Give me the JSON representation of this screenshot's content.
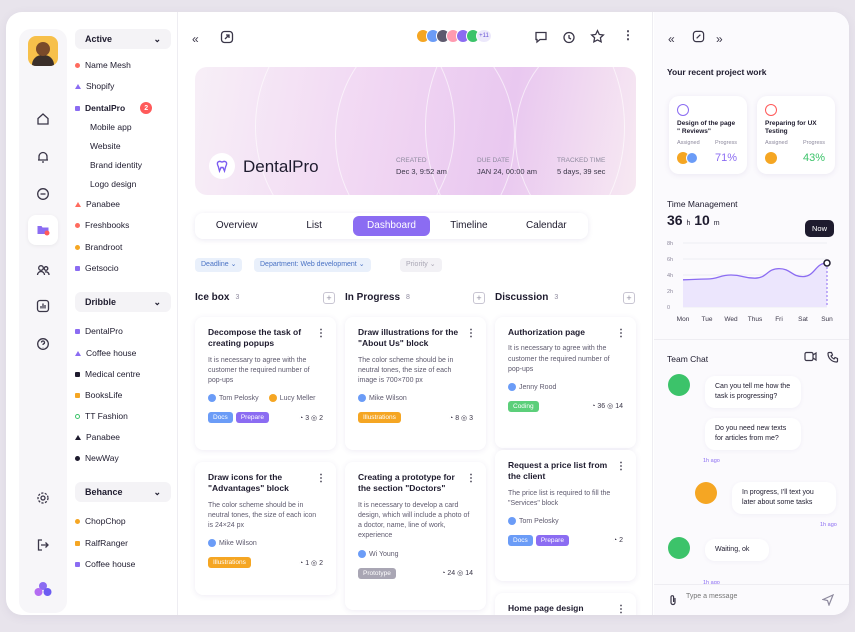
{
  "sidebar_workspaces": [
    {
      "select": "Active",
      "items": [
        {
          "label": "Name Mesh",
          "color": "#ff6b5e",
          "shape": "dot"
        },
        {
          "label": "Shopify",
          "color": "#8b6cf2",
          "shape": "tri"
        },
        {
          "label": "DentalPro",
          "color": "#8b6cf2",
          "shape": "sq",
          "badge": "2",
          "bold": true
        },
        {
          "label": "Mobile app",
          "sub": true
        },
        {
          "label": "Website",
          "sub": true
        },
        {
          "label": "Brand identity",
          "sub": true
        },
        {
          "label": "Logo design",
          "sub": true
        },
        {
          "label": "Panabee",
          "color": "#ff6b5e",
          "shape": "tri"
        },
        {
          "label": "Freshbooks",
          "color": "#ff6b5e",
          "shape": "dot"
        },
        {
          "label": "Brandroot",
          "color": "#f5a623",
          "shape": "dot"
        },
        {
          "label": "Getsocio",
          "color": "#8b6cf2",
          "shape": "sq"
        }
      ]
    },
    {
      "select": "Dribble",
      "items": [
        {
          "label": "DentalPro",
          "color": "#8b6cf2",
          "shape": "sq"
        },
        {
          "label": "Coffee house",
          "color": "#8b6cf2",
          "shape": "tri"
        },
        {
          "label": "Medical centre",
          "color": "#1e1b2e",
          "shape": "sq"
        },
        {
          "label": "BooksLife",
          "color": "#f5a623",
          "shape": "sq"
        },
        {
          "label": "TT Fashion",
          "color": "#3cc36a",
          "shape": "ring"
        },
        {
          "label": "Panabee",
          "color": "#1e1b2e",
          "shape": "tri"
        },
        {
          "label": "NewWay",
          "color": "#1e1b2e",
          "shape": "dot"
        }
      ]
    },
    {
      "select": "Behance",
      "items": [
        {
          "label": "ChopChop",
          "color": "#f5a623",
          "shape": "dot"
        },
        {
          "label": "RalfRanger",
          "color": "#f5a623",
          "shape": "sq"
        },
        {
          "label": "Coffee house",
          "color": "#8b6cf2",
          "shape": "sq"
        }
      ]
    }
  ],
  "header": {
    "people_more": "+11"
  },
  "project": {
    "name": "DentalPro",
    "created_label": "CREATED",
    "created": "Dec 3, 9:52 am",
    "due_label": "DUE DATE",
    "due": "JAN 24, 00:00 am",
    "tracked_label": "TRACKED TIME",
    "tracked": "5 days, 39 sec"
  },
  "tabs": [
    "Overview",
    "List",
    "Dashboard",
    "Timeline",
    "Calendar"
  ],
  "active_tab": "Dashboard",
  "filters": {
    "deadline": "Deadline",
    "department": "Department: Web development",
    "priority": "Priority"
  },
  "columns": [
    {
      "title": "Ice box",
      "count": "3",
      "cards": [
        {
          "title": "Decompose the task of creating popups",
          "desc": "It is necessary to agree with the customer the required number of pop-ups",
          "people": [
            "Tom Pelosky",
            "Lucy Meller"
          ],
          "tags": [
            {
              "t": "Docs",
              "c": "#6b9cf7"
            },
            {
              "t": "Prepare",
              "c": "#8b6cf2"
            }
          ],
          "comments": "3",
          "files": "2"
        },
        {
          "title": "Draw icons for the \"Advantages\" block",
          "desc": "The color scheme should be in neutral tones, the size of each icon is 24×24 px",
          "people": [
            "Mike Wilson"
          ],
          "tags": [
            {
              "t": "Illustrations",
              "c": "#f5a623"
            }
          ],
          "comments": "1",
          "files": "2"
        }
      ]
    },
    {
      "title": "In Progress",
      "count": "8",
      "cards": [
        {
          "title": "Draw illustrations for the \"About Us\" block",
          "desc": "The color scheme should be in neutral tones, the size of each image is 700×700 px",
          "people": [
            "Mike Wilson"
          ],
          "tags": [
            {
              "t": "Illustrations",
              "c": "#f5a623"
            }
          ],
          "comments": "8",
          "files": "3"
        },
        {
          "title": "Creating a prototype for the section \"Doctors\"",
          "desc": "It is necessary to develop a card design, which will include a photo of a doctor, name, line of work, experience",
          "people": [
            "Wi Young"
          ],
          "tags": [
            {
              "t": "Prototype",
              "c": "#a9a6b4"
            }
          ],
          "comments": "24",
          "files": "14"
        }
      ]
    },
    {
      "title": "Discussion",
      "count": "3",
      "cards": [
        {
          "title": "Authorization page",
          "desc": "It is necessary to agree with the customer the required number of pop-ups",
          "people": [
            "Jenny Rood"
          ],
          "tags": [
            {
              "t": "Coding",
              "c": "#5ccf7a"
            }
          ],
          "comments": "36",
          "files": "14"
        },
        {
          "title": "Request a price list from the client",
          "desc": "The price list is required to fill the \"Services\" block",
          "people": [
            "Tom Pelosky"
          ],
          "tags": [
            {
              "t": "Docs",
              "c": "#6b9cf7"
            },
            {
              "t": "Prepare",
              "c": "#8b6cf2"
            }
          ],
          "comments": "2",
          "files": ""
        },
        {
          "title": "Home page design",
          "desc": "",
          "people": [],
          "tags": [],
          "comments": "",
          "files": ""
        }
      ]
    }
  ],
  "right": {
    "recent_title": "Your recent project work",
    "recent": [
      {
        "title": "Design of the page \" Reviews\"",
        "assigned": "Assigned",
        "progress_label": "Progress",
        "progress": "71%",
        "color": "#8b6cf2"
      },
      {
        "title": "Preparing for UX Testing",
        "assigned": "Assigned",
        "progress_label": "Progress",
        "progress": "43%",
        "color": "#3cc36a"
      }
    ],
    "time_title": "Time Management",
    "time_h": "36",
    "time_h_unit": "h",
    "time_m": "10",
    "time_m_unit": "m",
    "now_label": "Now",
    "chat_title": "Team Chat",
    "messages": [
      {
        "text": "Can you tell me how the task is progressing?",
        "from": "other"
      },
      {
        "text": "Do you need new texts for articles from me?",
        "from": "other",
        "ago": "1h ago"
      },
      {
        "text": "In progress, I'll text you later about some tasks",
        "from": "me",
        "ago": "1h ago"
      },
      {
        "text": "Waiting, ok",
        "from": "other",
        "ago": "1h ago"
      }
    ],
    "input_placeholder": "Type a message"
  },
  "chart_data": {
    "type": "area",
    "title": "Time Management",
    "x": [
      "Mon",
      "Tue",
      "Wed",
      "Thus",
      "Fri",
      "Sat",
      "Sun"
    ],
    "y_ticks": [
      "8h",
      "6h",
      "4h",
      "2h",
      "0"
    ],
    "ylim": [
      0,
      8
    ],
    "values": [
      3.4,
      3.5,
      4.0,
      3.6,
      4.8,
      3.8,
      5.5
    ],
    "grid": true
  }
}
